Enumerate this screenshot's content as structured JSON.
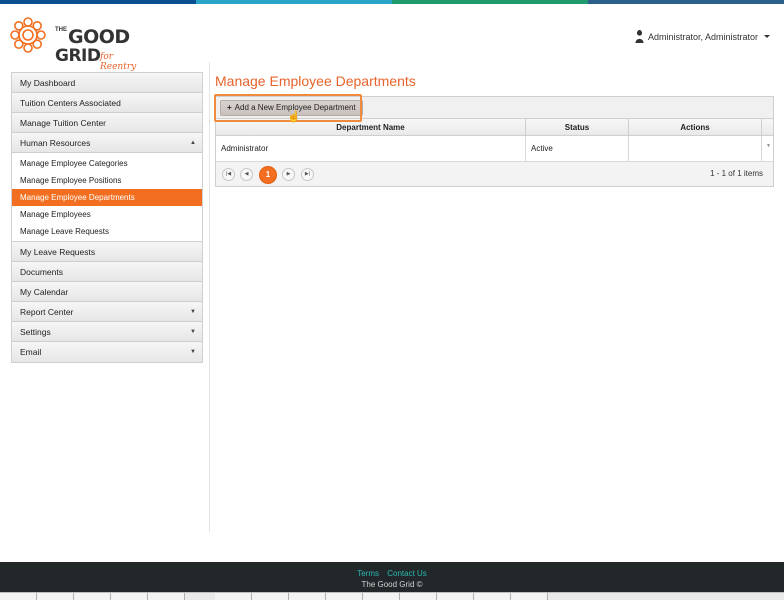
{
  "colors": {
    "accent": "#f26f21",
    "title": "#e8632b",
    "footer_bg": "#22282a",
    "footer_link": "#2ab7b0",
    "topbar": [
      "#0a4f8f",
      "#2aa5c7",
      "#1f9b6e",
      "#2c5f8a"
    ]
  },
  "header": {
    "logo": {
      "word_the": "THE",
      "word_good": "GOOD",
      "word_grid": "GRID",
      "word_for": "for Reentry",
      "icon": "gear-flower-logo-icon"
    },
    "user": {
      "icon": "user-avatar-icon",
      "name": "Administrator, Administrator"
    }
  },
  "sidebar": {
    "items": [
      {
        "label": "My Dashboard"
      },
      {
        "label": "Tuition Centers Associated"
      },
      {
        "label": "Manage Tuition Center"
      },
      {
        "label": "Human Resources",
        "expanded": true
      }
    ],
    "hr_subitems": [
      {
        "label": "Manage Employee Categories"
      },
      {
        "label": "Manage Employee Positions"
      },
      {
        "label": "Manage Employee Departments",
        "active": true
      },
      {
        "label": "Manage Employees"
      },
      {
        "label": "Manage Leave Requests"
      }
    ],
    "items_after": [
      {
        "label": "My Leave Requests"
      },
      {
        "label": "Documents"
      },
      {
        "label": "My Calendar"
      },
      {
        "label": "Report Center",
        "has_arrow": true
      },
      {
        "label": "Settings",
        "has_arrow": true
      },
      {
        "label": "Email",
        "has_arrow": true
      }
    ]
  },
  "main": {
    "title": "Manage Employee Departments",
    "add_button": "Add a New Employee Department",
    "table": {
      "columns": [
        "Department Name",
        "Status",
        "Actions"
      ],
      "rows": [
        {
          "name": "Administrator",
          "status": "Active",
          "actions": ""
        }
      ]
    },
    "pager": {
      "current_page": "1",
      "info": "1 - 1 of 1 items"
    }
  },
  "footer": {
    "terms": "Terms",
    "contact": "Contact Us",
    "copyright": "The Good Grid ©"
  }
}
